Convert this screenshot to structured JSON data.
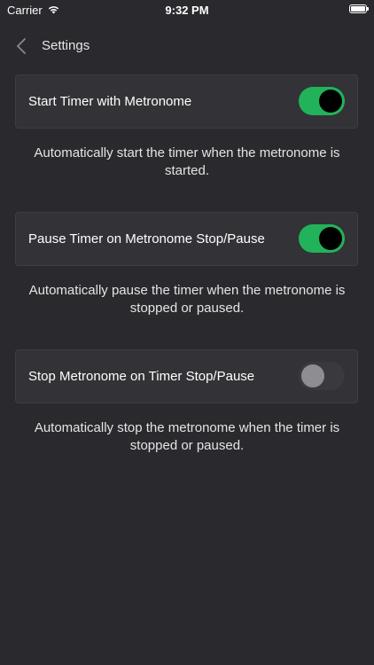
{
  "status_bar": {
    "carrier": "Carrier",
    "time": "9:32 PM"
  },
  "nav": {
    "title": "Settings"
  },
  "settings": [
    {
      "label": "Start Timer with Metronome",
      "enabled": true,
      "description": "Automatically start the timer when the metronome is started."
    },
    {
      "label": "Pause Timer on Metronome Stop/Pause",
      "enabled": true,
      "description": "Automatically pause the timer when the metronome is stopped or paused."
    },
    {
      "label": "Stop Metronome on Timer Stop/Pause",
      "enabled": false,
      "description": "Automatically stop the metronome when the timer is stopped or paused."
    }
  ],
  "colors": {
    "background": "#2a2a2e",
    "card": "#333337",
    "toggle_on": "#22b35a",
    "toggle_off": "#3a3a3e"
  }
}
